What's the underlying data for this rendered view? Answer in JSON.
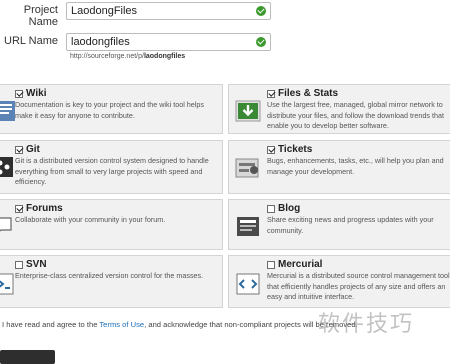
{
  "form": {
    "project_name_label": "Project Name",
    "project_name_value": "LaodongFiles",
    "url_name_label": "URL Name",
    "url_name_value": "laodongfiles",
    "url_hint_prefix": "http://sourceforge.net/p/",
    "url_hint_slug": "laodongfiles"
  },
  "features": [
    {
      "title": "Wiki",
      "checked": true,
      "icon": "wiki-icon",
      "desc": "Documentation is key to your project and the wiki tool helps make it easy for anyone to contribute."
    },
    {
      "title": "Files & Stats",
      "checked": true,
      "icon": "download-icon",
      "desc": "Use the largest free, managed, global mirror network to distribute your files, and follow the download trends that enable you to develop better software."
    },
    {
      "title": "Git",
      "checked": true,
      "icon": "git-icon",
      "desc": "Git is a distributed version control system designed to handle everything from small to very large projects with speed and efficiency."
    },
    {
      "title": "Tickets",
      "checked": true,
      "icon": "tickets-icon",
      "desc": "Bugs, enhancements, tasks, etc., will help you plan and manage your development."
    },
    {
      "title": "Forums",
      "checked": true,
      "icon": "forums-icon",
      "desc": "Collaborate with your community in your forum."
    },
    {
      "title": "Blog",
      "checked": false,
      "icon": "blog-icon",
      "desc": "Share exciting news and progress updates with your community."
    },
    {
      "title": "SVN",
      "checked": false,
      "icon": "svn-icon",
      "desc": "Enterprise-class centralized version control for the masses."
    },
    {
      "title": "Mercurial",
      "checked": false,
      "icon": "mercurial-icon",
      "desc": "Mercurial is a distributed source control management tool that efficiently handles projects of any size and offers an easy and intuitive interface."
    }
  ],
  "agreement": {
    "prefix": "I have read and agree to the ",
    "terms_link": "Terms of Use",
    "suffix": ", and acknowledge that non-compliant projects will be removed."
  },
  "watermark": "软件技巧"
}
